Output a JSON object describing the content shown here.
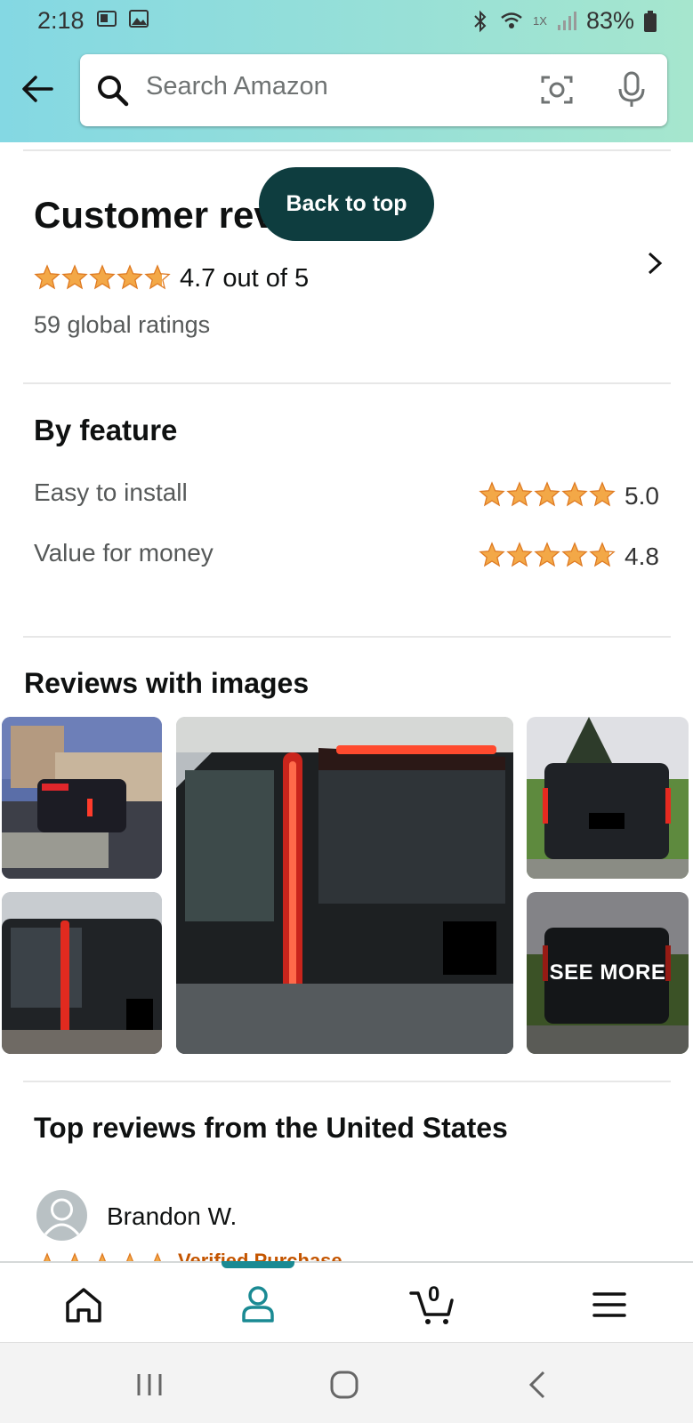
{
  "status_bar": {
    "time": "2:18",
    "network": "1X",
    "battery": "83%"
  },
  "search": {
    "placeholder": "Search Amazon"
  },
  "reviews": {
    "heading": "Customer reviews",
    "back_to_top": "Back to top",
    "rating_text": "4.7 out of 5",
    "rating_value": 4.7,
    "global_ratings": "59 global ratings"
  },
  "features": {
    "heading": "By feature",
    "items": [
      {
        "label": "Easy to install",
        "value": "5.0"
      },
      {
        "label": "Value for money",
        "value": "4.8"
      }
    ]
  },
  "images": {
    "heading": "Reviews with images",
    "see_more": "SEE MORE"
  },
  "top_reviews": {
    "heading": "Top reviews from the United States",
    "first_reviewer": "Brandon W.",
    "verified_label": "Verified Purchase"
  },
  "bottom_nav": {
    "items": [
      "home-icon",
      "account-icon",
      "cart-icon",
      "menu-icon"
    ],
    "active": "account-icon",
    "cart_count": "0"
  },
  "colors": {
    "header_start": "#84d8e3",
    "header_end": "#a6e6ce",
    "star": "#f3a847",
    "accent": "#1a8a93",
    "back_to_top": "#0e3d3f"
  }
}
